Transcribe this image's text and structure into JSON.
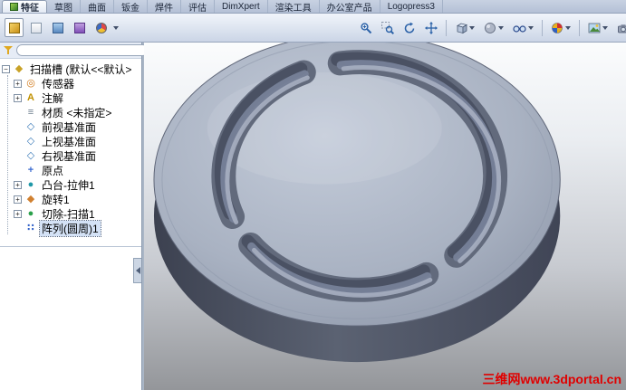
{
  "command_tabs": {
    "items": [
      {
        "label": "特征",
        "active": true
      },
      {
        "label": "草图"
      },
      {
        "label": "曲面"
      },
      {
        "label": "钣金"
      },
      {
        "label": "焊件"
      },
      {
        "label": "评估"
      },
      {
        "label": "DimXpert"
      },
      {
        "label": "渲染工具"
      },
      {
        "label": "办公室产品"
      },
      {
        "label": "Logopress3"
      }
    ]
  },
  "panel_tabs": {
    "items": [
      {
        "name": "feature-manager-tab",
        "active": true
      },
      {
        "name": "property-manager-tab"
      },
      {
        "name": "configuration-manager-tab"
      },
      {
        "name": "dimxpert-manager-tab"
      },
      {
        "name": "display-manager-tab"
      }
    ]
  },
  "view_toolbar": {
    "buttons": [
      {
        "name": "zoom-fit"
      },
      {
        "name": "zoom-to-area"
      },
      {
        "name": "rotate-view"
      },
      {
        "name": "pan"
      },
      {
        "name": "view-orientation",
        "dropdown": true
      },
      {
        "name": "display-style",
        "dropdown": true
      },
      {
        "name": "hide-show-items",
        "dropdown": true
      },
      {
        "name": "edit-appearance",
        "dropdown": true
      },
      {
        "name": "apply-scene",
        "dropdown": true
      },
      {
        "name": "view-settings",
        "dropdown": true
      }
    ]
  },
  "feature_tree": {
    "root": {
      "label": "扫描槽 (默认<<默认>",
      "glyph": "◆",
      "expanded": "−"
    },
    "items": [
      {
        "label": "传感器",
        "glyph": "◎",
        "expand": "+"
      },
      {
        "label": "注解",
        "glyph": "A",
        "expand": "+"
      },
      {
        "label": "材质 <未指定>",
        "glyph": "≡"
      },
      {
        "label": "前视基准面",
        "glyph": "◇"
      },
      {
        "label": "上视基准面",
        "glyph": "◇"
      },
      {
        "label": "右视基准面",
        "glyph": "◇"
      },
      {
        "label": "原点",
        "glyph": "+"
      },
      {
        "label": "凸台-拉伸1",
        "glyph": "●",
        "expand": "+"
      },
      {
        "label": "旋转1",
        "glyph": "◆",
        "expand": "+"
      },
      {
        "label": "切除-扫描1",
        "glyph": "●",
        "expand": "+"
      },
      {
        "label": "阵列(圆周)1",
        "glyph": "∷",
        "selected": true
      }
    ]
  },
  "viewport": {
    "watermark": "三维网www.3dportal.cn"
  },
  "colors": {
    "watermark_red": "#e00000",
    "selection_blue": "#d4e2f6",
    "toolbar_top": "#f1f5fb",
    "toolbar_bottom": "#cbd5e6",
    "viewport_top": "#fbfcfd",
    "viewport_bottom": "#94969a",
    "part_face": "#aab2c2",
    "part_wall": "#4a505e",
    "groove_dark": "#4a5163"
  }
}
